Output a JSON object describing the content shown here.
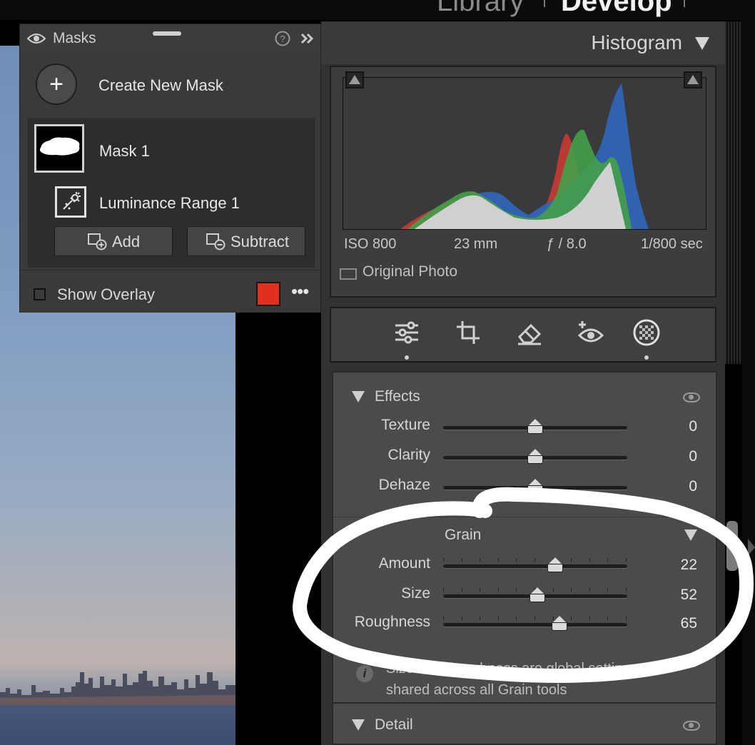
{
  "modules": {
    "library": "Library",
    "develop": "Develop"
  },
  "masks": {
    "title": "Masks",
    "help_icon": "question-circle-icon",
    "collapse_icon": "double-chevron-right-icon",
    "create_label": "Create New Mask",
    "mask_name": "Mask 1",
    "component_name": "Luminance Range 1",
    "add_label": "Add",
    "subtract_label": "Subtract",
    "overlay_label": "Show Overlay",
    "overlay_color": "#e0301e",
    "more": "•••"
  },
  "histogram": {
    "title": "Histogram",
    "iso": "ISO 800",
    "focal_length": "23 mm",
    "aperture": "ƒ / 8.0",
    "shutter": "1/800 sec",
    "original_photo_label": "Original Photo"
  },
  "tools": [
    "edit-sliders-icon",
    "crop-icon",
    "eraser-icon",
    "red-eye-icon",
    "masking-icon"
  ],
  "effects": {
    "title": "Effects",
    "sliders": [
      {
        "label": "Texture",
        "value": "0",
        "position": 0.5
      },
      {
        "label": "Clarity",
        "value": "0",
        "position": 0.5
      },
      {
        "label": "Dehaze",
        "value": "0",
        "position": 0.5
      }
    ]
  },
  "grain": {
    "title": "Grain",
    "sliders": [
      {
        "label": "Amount",
        "value": "22",
        "position": 0.61
      },
      {
        "label": "Size",
        "value": "52",
        "position": 0.51
      },
      {
        "label": "Roughness",
        "value": "65",
        "position": 0.63
      }
    ],
    "note": "Size and Roughness are global settings and shared across all Grain tools"
  },
  "detail": {
    "title": "Detail"
  }
}
